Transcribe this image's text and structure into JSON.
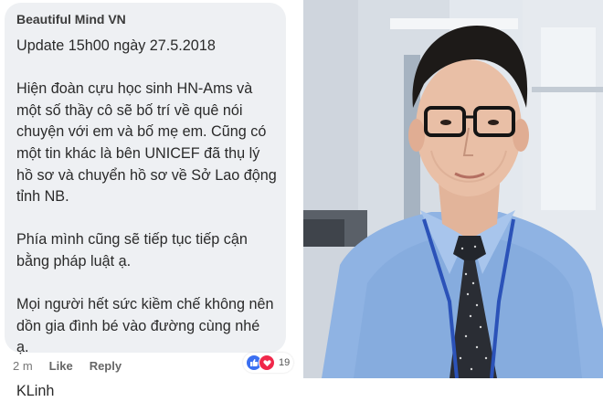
{
  "comment": {
    "author": "Beautiful Mind VN",
    "lines": [
      "Update 15h00 ngày 27.5.2018",
      "",
      "Hiện đoàn cựu học sinh HN-Ams và",
      "một số thầy cô sẽ bố trí về quê nói",
      "chuyện với em và bố mẹ em. Cũng có",
      "một tin khác là bên UNICEF đã thụ lý",
      "hồ sơ và chuyển hồ sơ về Sở Lao động",
      "tỉnh NB.",
      "",
      "Phía mình cũng sẽ tiếp tục tiếp cận",
      "bằng pháp luật ạ.",
      "",
      "Mọi người hết sức kiềm chế không nên",
      "dồn gia đình bé vào đường cùng  nhé",
      "ạ.",
      "",
      "KLinh"
    ],
    "time": "2 m",
    "like_label": "Like",
    "reply_label": "Reply",
    "reaction_count": "19",
    "colors": {
      "bubble": "#eef0f3",
      "like": "#3b6ff1",
      "love": "#f0284a"
    }
  },
  "photo": {
    "subject": "selfie of man in blue shirt, black glasses, polka-dot tie, lanyard",
    "icons": [
      "like-icon",
      "love-icon"
    ]
  }
}
